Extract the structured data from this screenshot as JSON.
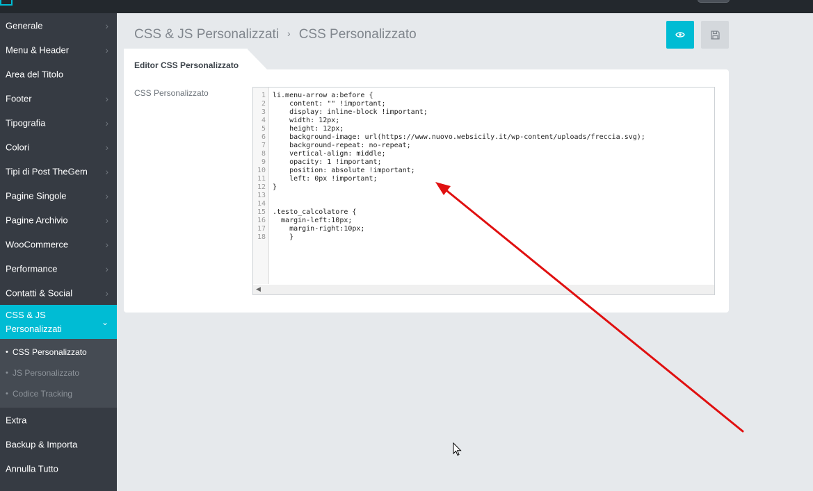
{
  "colors": {
    "accent": "#00bcd4",
    "sidebar_bg": "#363b43",
    "annotation": "#e01010"
  },
  "sidebar": {
    "items": [
      {
        "label": "Generale",
        "chevron": "›"
      },
      {
        "label": "Menu & Header",
        "chevron": "›"
      },
      {
        "label": "Area del Titolo",
        "chevron": ""
      },
      {
        "label": "Footer",
        "chevron": "›"
      },
      {
        "label": "Tipografia",
        "chevron": "›"
      },
      {
        "label": "Colori",
        "chevron": "›"
      },
      {
        "label": "Tipi di Post TheGem",
        "chevron": "›"
      },
      {
        "label": "Pagine Singole",
        "chevron": "›"
      },
      {
        "label": "Pagine Archivio",
        "chevron": "›"
      },
      {
        "label": "WooCommerce",
        "chevron": "›"
      },
      {
        "label": "Performance",
        "chevron": "›"
      },
      {
        "label": "Contatti & Social",
        "chevron": "›"
      }
    ],
    "active_item": {
      "label": "CSS & JS Personalizzati",
      "chevron": "⌄"
    },
    "sub_items": [
      {
        "label": "CSS Personalizzato",
        "bullet": "•"
      },
      {
        "label": "JS Personalizzato",
        "bullet": "•"
      },
      {
        "label": "Codice Tracking",
        "bullet": "•"
      }
    ],
    "bottom_items": [
      {
        "label": "Extra"
      },
      {
        "label": "Backup & Importa"
      },
      {
        "label": "Annulla Tutto"
      }
    ]
  },
  "breadcrumb": {
    "section": "CSS & JS Personalizzati",
    "separator": "›",
    "page": "CSS Personalizzato"
  },
  "toolbar": {
    "preview_icon": "eye-icon",
    "save_icon": "floppy-disk-icon"
  },
  "tab": {
    "label": "Editor CSS Personalizzato"
  },
  "field": {
    "label": "CSS Personalizzato"
  },
  "editor": {
    "line_numbers": [
      "1",
      "2",
      "3",
      "4",
      "5",
      "6",
      "7",
      "8",
      "9",
      "10",
      "11",
      "12",
      "13",
      "14",
      "15",
      "16",
      "17",
      "18"
    ],
    "lines": [
      "li.menu-arrow a:before {",
      "    content: \"\" !important;",
      "    display: inline-block !important;",
      "    width: 12px;",
      "    height: 12px;",
      "    background-image: url(https://www.nuovo.websicily.it/wp-content/uploads/freccia.svg);",
      "    background-repeat: no-repeat;",
      "    vertical-align: middle;",
      "    opacity: 1 !important;",
      "    position: absolute !important;",
      "    left: 0px !important;",
      "}",
      "",
      "",
      ".testo_calcolatore {",
      "  margin-left:10px;",
      "    margin-right:10px;",
      "    }"
    ],
    "scroll_arrow": "◀"
  }
}
